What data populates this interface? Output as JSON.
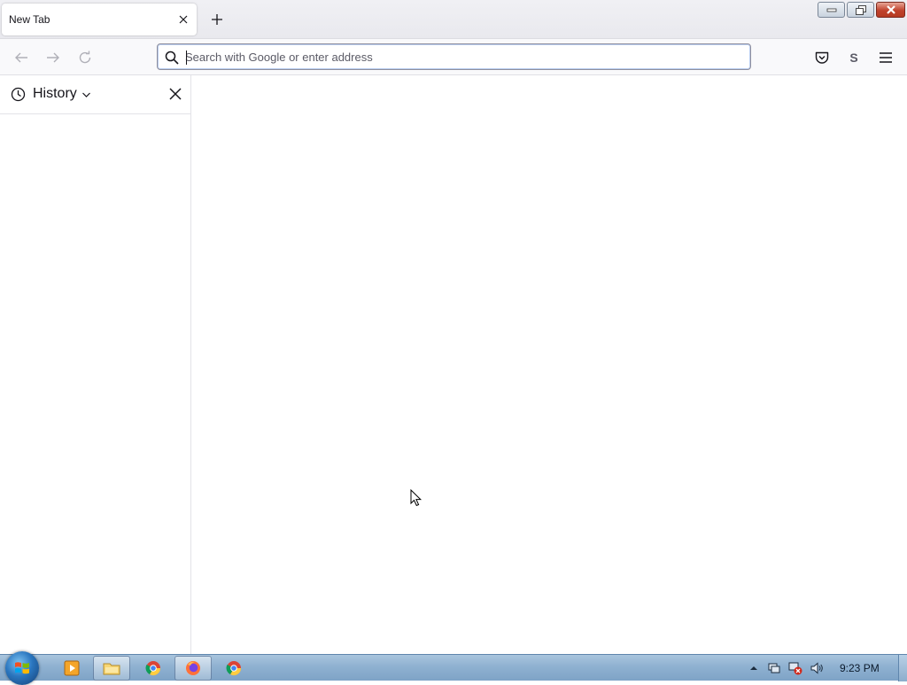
{
  "browser": {
    "tab": {
      "title": "New Tab"
    },
    "urlbar": {
      "placeholder": "Search with Google or enter address",
      "value": ""
    },
    "toolbar_icons": [
      "back-icon",
      "forward-icon",
      "reload-icon",
      "pocket-icon",
      "account-icon",
      "menu-icon"
    ],
    "account_initial": "S"
  },
  "sidebar": {
    "title": "History"
  },
  "taskbar": {
    "clock": "9:23 PM",
    "items": [
      "media-player-icon",
      "file-explorer-icon",
      "chrome-icon",
      "firefox-icon",
      "chrome-icon"
    ]
  },
  "colors": {
    "accent": "#0060df",
    "taskbar": "#8fb1d1"
  }
}
